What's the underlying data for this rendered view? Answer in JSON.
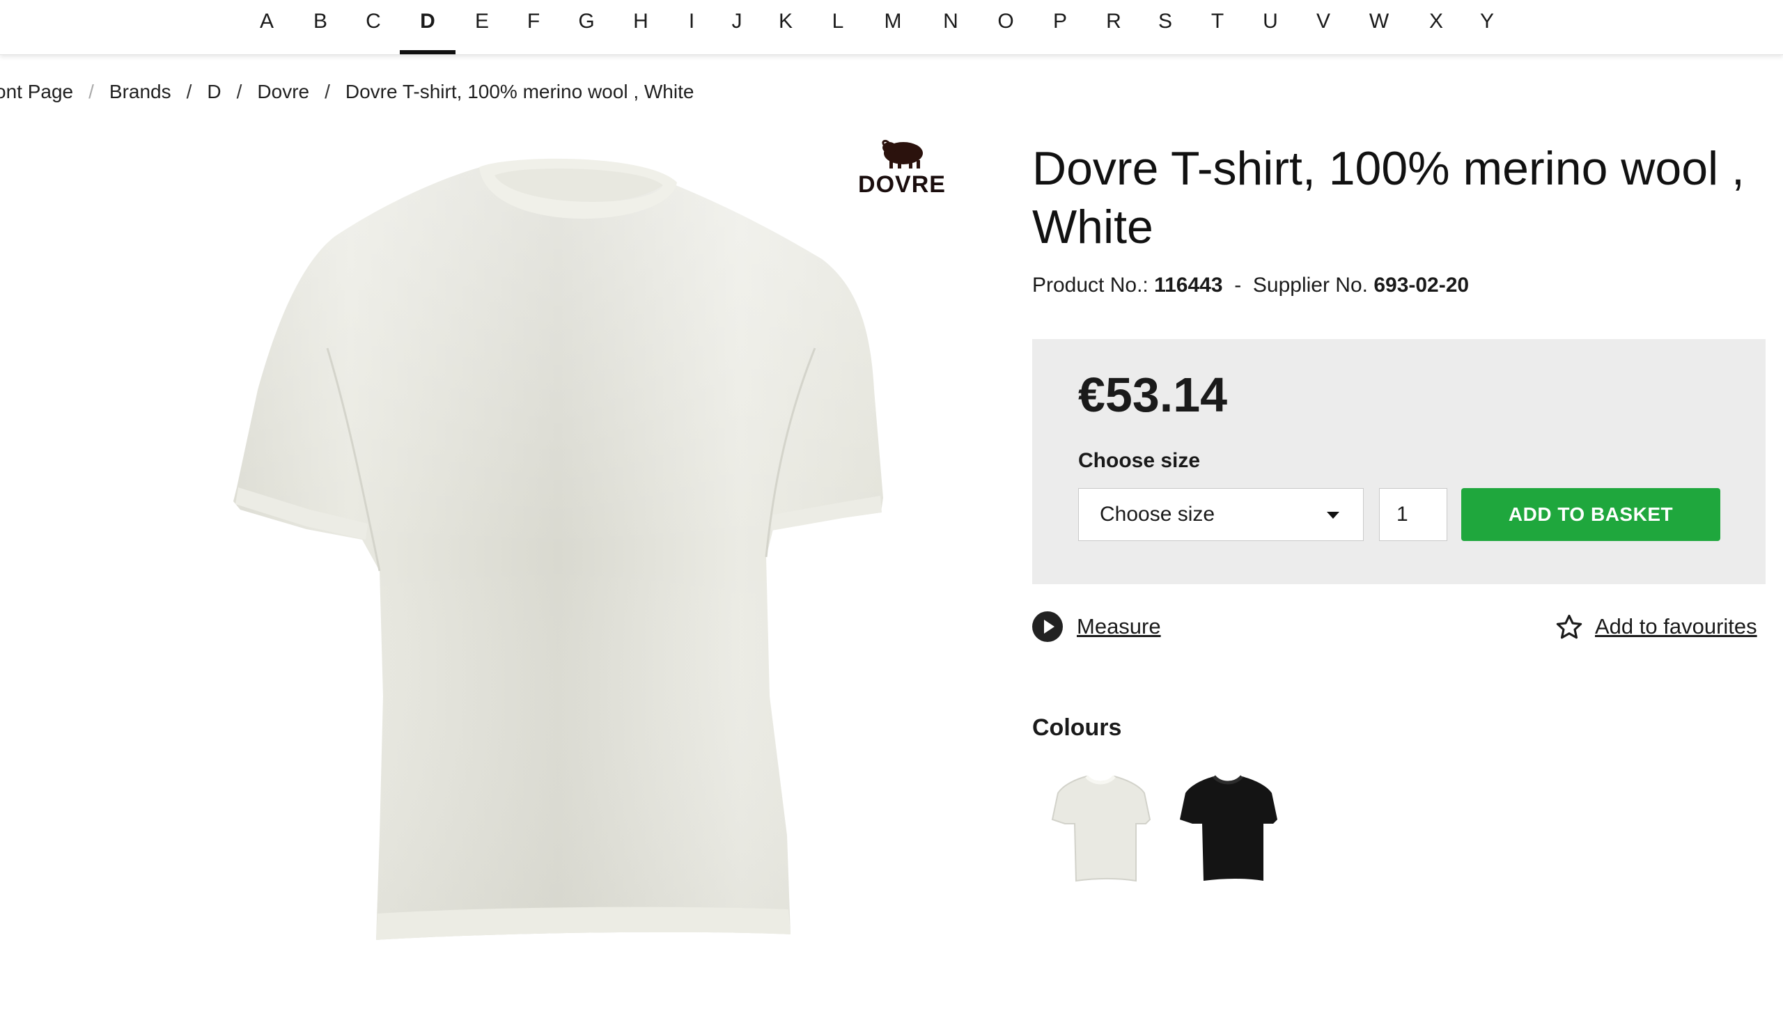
{
  "alphabet": {
    "letters": [
      "A",
      "B",
      "C",
      "D",
      "E",
      "F",
      "G",
      "H",
      "I",
      "J",
      "K",
      "L",
      "M",
      "N",
      "O",
      "P",
      "R",
      "S",
      "T",
      "U",
      "V",
      "W",
      "X",
      "Y"
    ],
    "active": "D"
  },
  "breadcrumb": {
    "items": [
      "ont Page",
      "Brands",
      "D",
      "Dovre",
      "Dovre T-shirt, 100% merino wool , White"
    ],
    "separator": "/"
  },
  "brand": {
    "logo_text": "DOVRE"
  },
  "product": {
    "title": "Dovre T-shirt, 100% merino wool , White",
    "product_no_label": "Product No.:",
    "product_no": "116443",
    "meta_separator": "-",
    "supplier_no_label": "Supplier No.",
    "supplier_no": "693-02-20",
    "image_icon": "white-tshirt-image"
  },
  "purchase": {
    "price": "€53.14",
    "size_label": "Choose size",
    "size_select_value": "Choose size",
    "quantity": "1",
    "add_button": "ADD TO BASKET",
    "colors": {
      "button": "#1fa73d",
      "box": "#ececec"
    }
  },
  "links": {
    "measure": "Measure",
    "measure_icon": "play-circle-icon",
    "favourites": "Add to favourites",
    "favourites_icon": "star-outline-icon"
  },
  "colours": {
    "heading": "Colours",
    "swatches": [
      {
        "name": "White",
        "color": "#f2f1ea"
      },
      {
        "name": "Black",
        "color": "#141414"
      }
    ]
  }
}
